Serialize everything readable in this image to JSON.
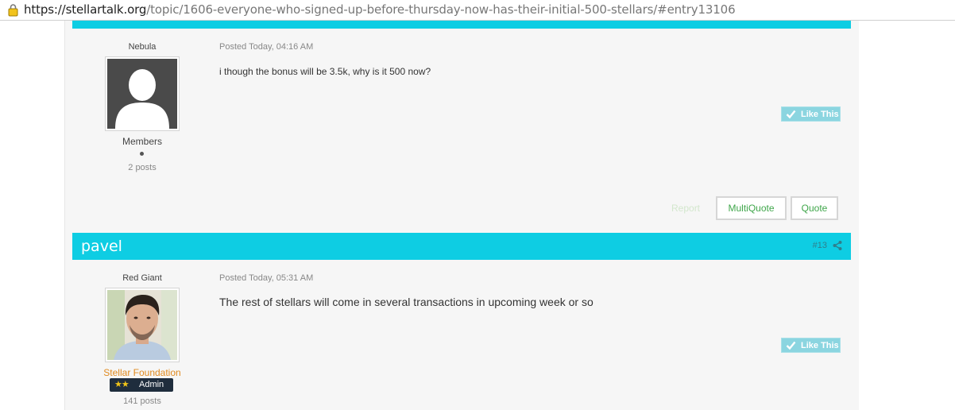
{
  "browser": {
    "url_host": "https://stellartalk.org",
    "url_path": "/topic/1606-everyone-who-signed-up-before-thursday-now-has-their-initial-500-stellars/#entry13106"
  },
  "posts": [
    {
      "author": "Nebula",
      "posted": "Posted Today, 04:16 AM",
      "content": "i though the bonus will be 3.5k, why is it 500 now?",
      "group": "Members",
      "posts_count": "2 posts",
      "like_label": "Like This",
      "actions": {
        "report": "Report",
        "multiquote": "MultiQuote",
        "quote": "Quote"
      }
    },
    {
      "author": "pavel",
      "title": "Red Giant",
      "number": "#13",
      "posted": "Posted Today, 05:31 AM",
      "content": "The rest of stellars will come in several transactions in upcoming week or so",
      "group": "Stellar Foundation",
      "badge_stars": "★★",
      "badge": "Admin",
      "posts_count": "141 posts",
      "like_label": "Like This"
    }
  ],
  "colors": {
    "accent": "#0ecde3",
    "like": "#8bd5e0",
    "quote_text": "#3fa64a",
    "foundation": "#e08a1f"
  }
}
